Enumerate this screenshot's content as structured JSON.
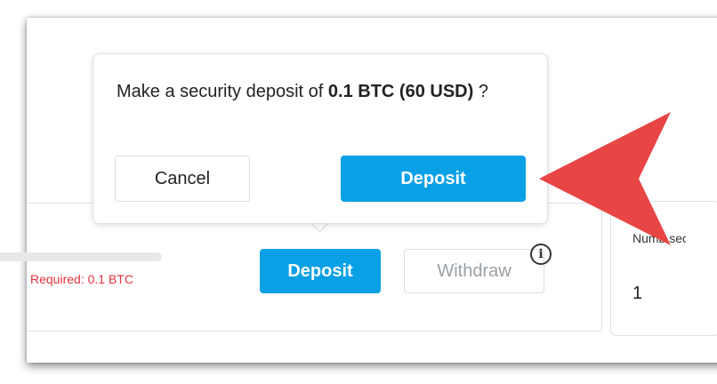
{
  "popover": {
    "message_prefix": "Make a security deposit of ",
    "amount": "0.1 BTC (60 USD)",
    "message_suffix": " ?",
    "cancel_label": "Cancel",
    "deposit_label": "Deposit"
  },
  "panel": {
    "required_text": "Required: 0.1 BTC",
    "deposit_label": "Deposit",
    "withdraw_label": "Withdraw",
    "info_glyph": "i"
  },
  "side_card": {
    "label": "Numb secur",
    "value": "1"
  },
  "colors": {
    "primary": "#0aa0e6",
    "required": "#e5323e",
    "annotation_arrow": "#e84545"
  }
}
